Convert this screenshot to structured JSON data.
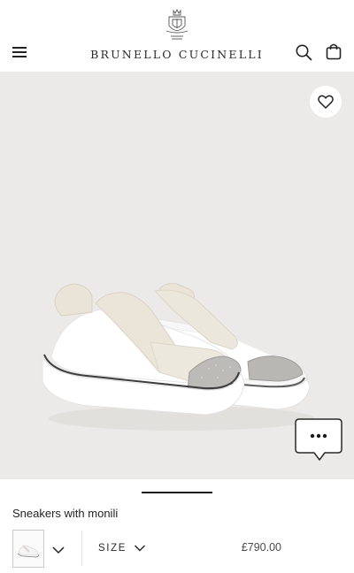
{
  "header": {
    "brand": "BRUNELLO CUCINELLI",
    "menu_icon": "hamburger-menu-icon",
    "search_icon": "search-icon",
    "bag_icon": "shopping-bag-icon"
  },
  "gallery": {
    "background_color": "#eceae8",
    "favorite_icon": "heart-icon",
    "chat_icon": "chat-bubble-icon",
    "chat_label": "•••"
  },
  "product": {
    "name": "Sneakers with monili",
    "size_label": "SIZE",
    "price": "£790.00"
  }
}
